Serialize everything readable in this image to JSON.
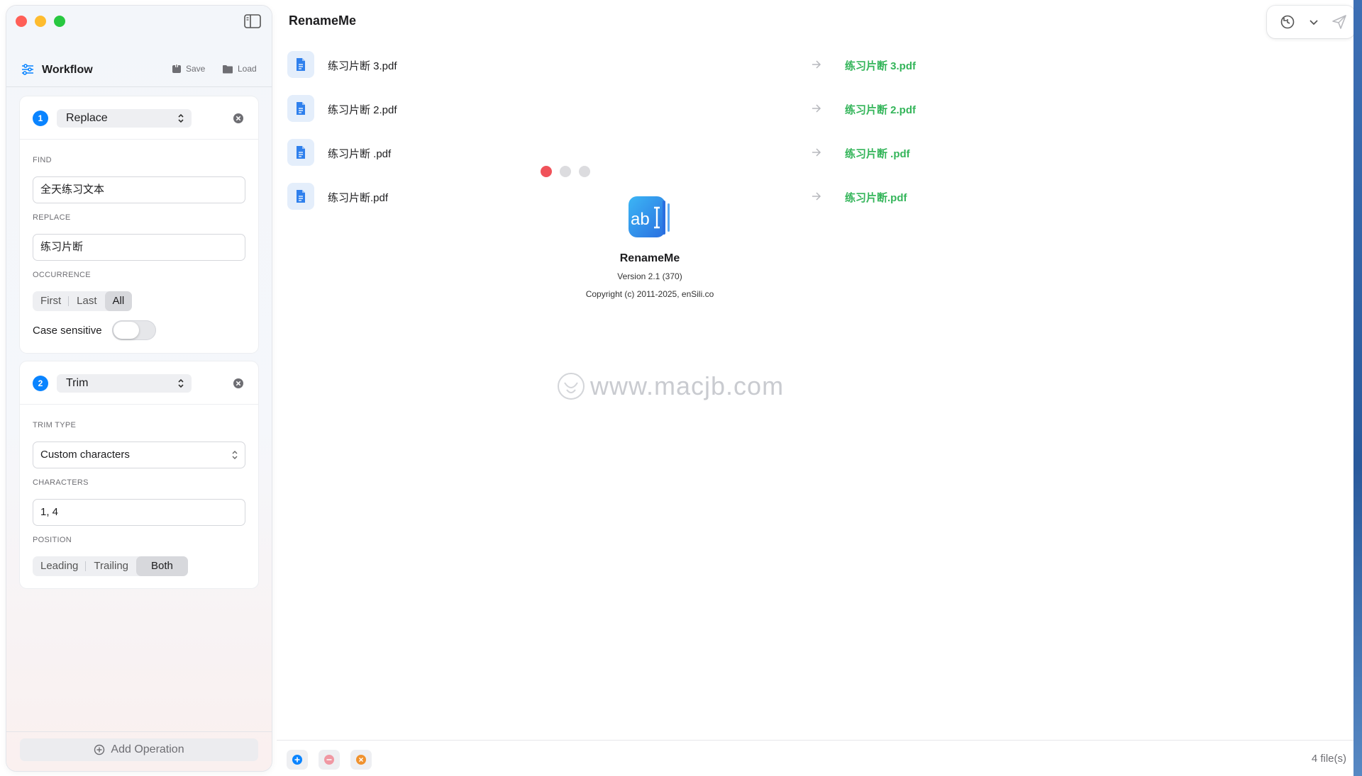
{
  "app": {
    "title": "RenameMe"
  },
  "sidebar": {
    "workflow_title": "Workflow",
    "save_label": "Save",
    "load_label": "Load",
    "add_operation_label": "Add Operation",
    "operations": [
      {
        "index": "1",
        "type": "Replace",
        "find_label": "FIND",
        "find_value": "全天练习文本",
        "replace_label": "REPLACE",
        "replace_value": "练习片断",
        "occurrence_label": "OCCURRENCE",
        "occurrence_options": [
          "First",
          "Last",
          "All"
        ],
        "occurrence_selected": "All",
        "case_sensitive_label": "Case sensitive",
        "case_sensitive": false
      },
      {
        "index": "2",
        "type": "Trim",
        "trim_type_label": "TRIM TYPE",
        "trim_type_value": "Custom characters",
        "characters_label": "CHARACTERS",
        "characters_value": "1,  4",
        "position_label": "POSITION",
        "position_options": [
          "Leading",
          "Trailing",
          "Both"
        ],
        "position_selected": "Both"
      }
    ]
  },
  "files": [
    {
      "original": "练习片断 3.pdf",
      "renamed": "练习片断 3.pdf"
    },
    {
      "original": "练习片断 2.pdf",
      "renamed": "练习片断 2.pdf"
    },
    {
      "original": "练习片断 .pdf",
      "renamed": "练习片断 .pdf"
    },
    {
      "original": "练习片断.pdf",
      "renamed": "练习片断.pdf"
    }
  ],
  "about": {
    "name": "RenameMe",
    "version": "Version 2.1 (370)",
    "copyright": "Copyright (c) 2011-2025, enSili.co",
    "logo_text": "ab"
  },
  "watermark": {
    "text": "www.macjb.com"
  },
  "status": {
    "file_count": "4 file(s)"
  },
  "colors": {
    "accent": "#0a84ff",
    "renamed_text": "#34b55a",
    "add_button": "#0a84ff",
    "remove_button": "#f26b7a",
    "clear_button": "#f0922e"
  },
  "icons": {
    "toolbar": [
      "revert-icon",
      "chevron-down-icon",
      "send-icon"
    ],
    "bottom": [
      "add-file-icon",
      "remove-file-icon",
      "clear-files-icon"
    ]
  }
}
